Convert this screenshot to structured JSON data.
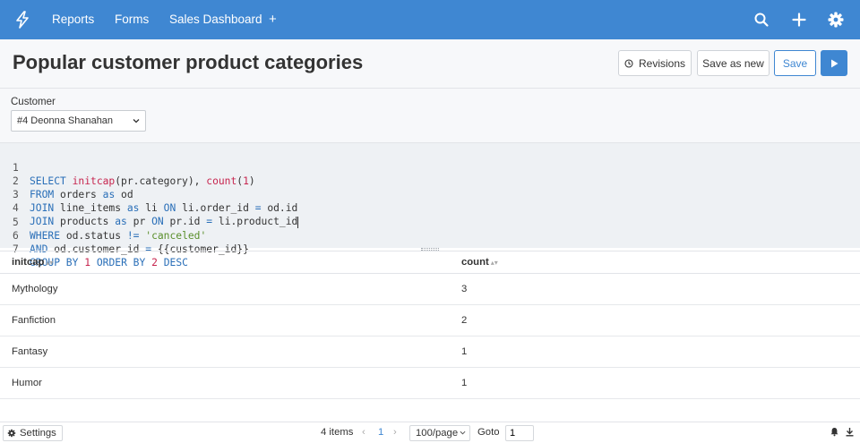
{
  "nav": {
    "items": [
      "Reports",
      "Forms",
      "Sales Dashboard"
    ],
    "add_label": "+"
  },
  "header": {
    "title": "Popular customer product categories",
    "revisions_label": "Revisions",
    "save_as_new_label": "Save as new",
    "save_label": "Save"
  },
  "params": {
    "customer_label": "Customer",
    "customer_value": "#4 Deonna Shanahan"
  },
  "editor": {
    "line_numbers": [
      "1",
      "2",
      "3",
      "4",
      "5",
      "6",
      "7"
    ]
  },
  "table": {
    "columns": [
      "initcap",
      "count"
    ],
    "rows": [
      [
        "Mythology",
        "3"
      ],
      [
        "Fanfiction",
        "2"
      ],
      [
        "Fantasy",
        "1"
      ],
      [
        "Humor",
        "1"
      ]
    ]
  },
  "footer": {
    "settings_label": "Settings",
    "item_count": "4 items",
    "prev": "‹",
    "current_page": "1",
    "next": "›",
    "per_page": "100/page",
    "goto_label": "Goto",
    "goto_value": "1"
  },
  "colors": {
    "accent": "#3f87d2",
    "keyword": "#2a6fb8",
    "function": "#c7254e",
    "string": "#5a8f2b"
  },
  "icons": [
    "bolt-icon",
    "search-icon",
    "plus-icon",
    "gear-icon",
    "clock-icon",
    "play-icon",
    "chevron-down-icon",
    "bell-icon",
    "download-icon"
  ]
}
